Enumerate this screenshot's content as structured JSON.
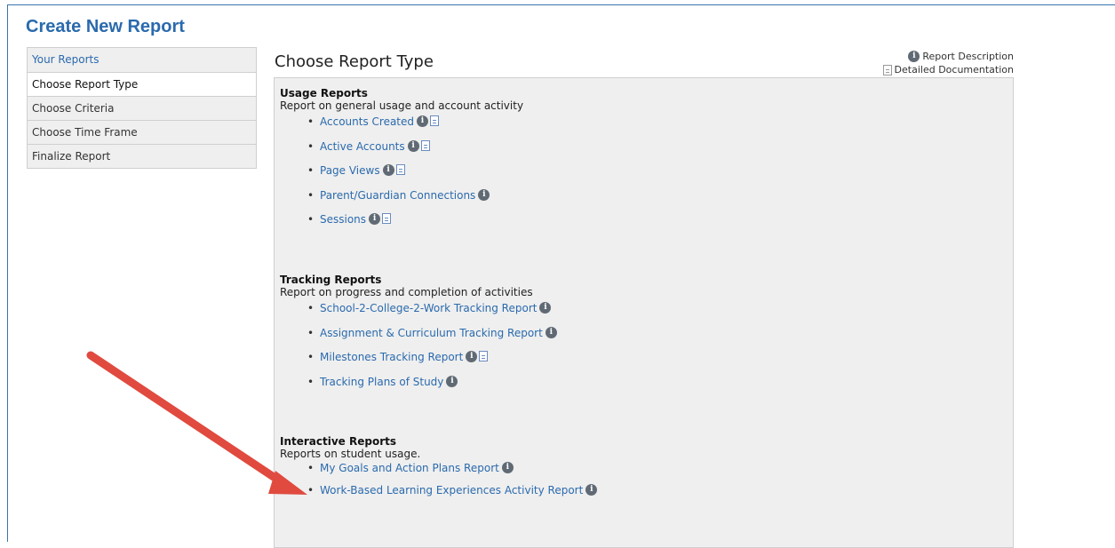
{
  "page_title": "Create New Report",
  "nav": [
    {
      "label": "Your Reports",
      "state": "link"
    },
    {
      "label": "Choose Report Type",
      "state": "active"
    },
    {
      "label": "Choose Criteria",
      "state": "inactive"
    },
    {
      "label": "Choose Time Frame",
      "state": "inactive"
    },
    {
      "label": "Finalize Report",
      "state": "inactive"
    }
  ],
  "section_title": "Choose Report Type",
  "legend": {
    "info_label": "Report Description",
    "doc_label": "Detailed Documentation"
  },
  "groups": [
    {
      "title": "Usage Reports",
      "description": "Report on general usage and account activity",
      "reports": [
        {
          "label": "Accounts Created",
          "info": true,
          "doc": true
        },
        {
          "label": "Active Accounts",
          "info": true,
          "doc": true
        },
        {
          "label": "Page Views",
          "info": true,
          "doc": true
        },
        {
          "label": "Parent/Guardian Connections",
          "info": true,
          "doc": false
        },
        {
          "label": "Sessions",
          "info": true,
          "doc": true
        }
      ]
    },
    {
      "title": "Tracking Reports",
      "description": "Report on progress and completion of activities",
      "reports": [
        {
          "label": "School-2-College-2-Work Tracking Report",
          "info": true,
          "doc": false
        },
        {
          "label": "Assignment & Curriculum Tracking Report",
          "info": true,
          "doc": false
        },
        {
          "label": "Milestones Tracking Report",
          "info": true,
          "doc": true
        },
        {
          "label": "Tracking Plans of Study",
          "info": true,
          "doc": false
        }
      ]
    },
    {
      "title": "Interactive Reports",
      "description": "Reports on student usage.",
      "reports": [
        {
          "label": "My Goals and Action Plans Report",
          "info": true,
          "doc": false
        },
        {
          "label": "Work-Based Learning Experiences Activity Report",
          "info": true,
          "doc": false
        }
      ]
    }
  ],
  "icons": {
    "info_glyph": "i"
  },
  "colors": {
    "accent": "#2a6aad",
    "panel_bg": "#efefef",
    "annotation_arrow": "#e04a3f"
  }
}
